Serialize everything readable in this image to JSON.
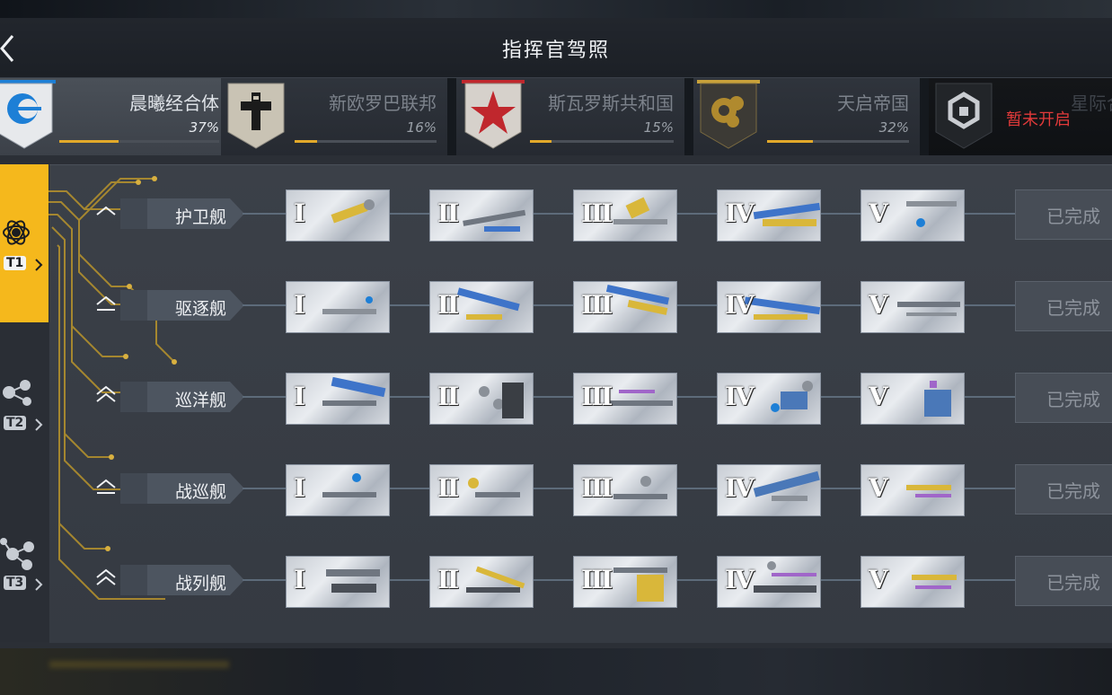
{
  "header": {
    "title": "指挥官驾照",
    "back_icon": "back-arrow-icon"
  },
  "factions": [
    {
      "name": "晨曦经合体",
      "percent": "37%",
      "progress": 0.37,
      "state": "active",
      "icon": "crescent-emblem-icon",
      "emblem_color": "#1d7fd6"
    },
    {
      "name": "新欧罗巴联邦",
      "percent": "16%",
      "progress": 0.16,
      "state": "normal",
      "icon": "cross-emblem-icon",
      "emblem_color": "#1b1b1b"
    },
    {
      "name": "斯瓦罗斯共和国",
      "percent": "15%",
      "progress": 0.15,
      "state": "normal",
      "icon": "red-star-emblem-icon",
      "emblem_color": "#c0272d"
    },
    {
      "name": "天启帝国",
      "percent": "32%",
      "progress": 0.32,
      "state": "normal",
      "icon": "orb-emblem-icon",
      "emblem_color": "#b08a2e"
    },
    {
      "name": "星际合",
      "status": "暂未开启",
      "state": "locked",
      "icon": "hex-emblem-icon",
      "emblem_color": "#2a2d31"
    }
  ],
  "tiers": [
    {
      "label": "T1",
      "active": true
    },
    {
      "label": "T2",
      "active": false
    },
    {
      "label": "T3",
      "active": false
    }
  ],
  "ship_classes": [
    {
      "name": "护卫舰",
      "rank_icon": "rank-chevron-1-icon",
      "levels": [
        "I",
        "II",
        "III",
        "IV",
        "V"
      ],
      "status": "已完成"
    },
    {
      "name": "驱逐舰",
      "rank_icon": "rank-chevron-2-icon",
      "levels": [
        "I",
        "II",
        "III",
        "IV",
        "V"
      ],
      "status": "已完成"
    },
    {
      "name": "巡洋舰",
      "rank_icon": "rank-chevron-3-icon",
      "levels": [
        "I",
        "II",
        "III",
        "IV",
        "V"
      ],
      "status": "已完成"
    },
    {
      "name": "战巡舰",
      "rank_icon": "rank-chevron-2-icon",
      "levels": [
        "I",
        "II",
        "III",
        "IV",
        "V"
      ],
      "status": "已完成"
    },
    {
      "name": "战列舰",
      "rank_icon": "rank-chevron-3-icon",
      "levels": [
        "I",
        "II",
        "III",
        "IV",
        "V"
      ],
      "status": "已完成"
    }
  ],
  "colors": {
    "accent": "#f5b81c",
    "locked_text": "#e23a3a",
    "progress": "#e2a92a"
  }
}
